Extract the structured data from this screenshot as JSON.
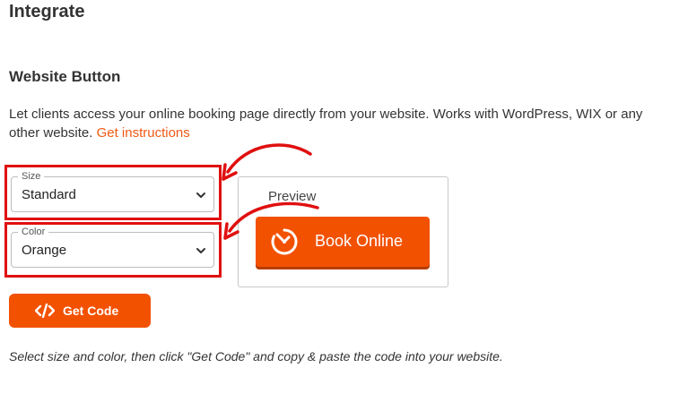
{
  "page": {
    "title": "Integrate"
  },
  "section": {
    "title": "Website Button",
    "description": "Let clients access your online booking page directly from your website. Works with WordPress, WIX or any other website. ",
    "instructions_link": "Get instructions"
  },
  "size_select": {
    "label": "Size",
    "value": "Standard"
  },
  "color_select": {
    "label": "Color",
    "value": "Orange"
  },
  "preview": {
    "label": "Preview",
    "button_label": "Book Online"
  },
  "get_code_button": {
    "label": "Get Code"
  },
  "hint": "Select size and color, then click \"Get Code\" and copy & paste the code into your website.",
  "colors": {
    "accent": "#f25100",
    "link": "#f05a14",
    "highlight": "#e01010"
  }
}
